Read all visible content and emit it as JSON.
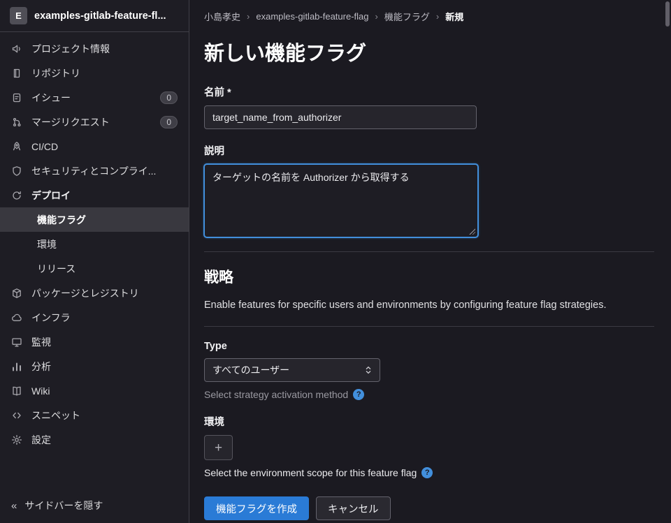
{
  "colors": {
    "page_bg": "#1b1a21",
    "sidebar_bg": "#1e1d24",
    "border": "#403f47",
    "control_border": "#63626c",
    "control_bg": "#26252c",
    "accent_blue": "#428fdc",
    "primary_button": "#2a7bd6",
    "active_item_bg": "#39383f",
    "text_primary": "#ececef",
    "text_muted": "#9a99a1"
  },
  "icons": {
    "help_glyph": "?",
    "collapse_glyph": "«",
    "plus_glyph": "+"
  },
  "sidebar": {
    "project_initial": "E",
    "project_name": "examples-gitlab-feature-fl...",
    "items": [
      {
        "label": "プロジェクト情報"
      },
      {
        "label": "リポジトリ"
      },
      {
        "label": "イシュー",
        "badge": "0"
      },
      {
        "label": "マージリクエスト",
        "badge": "0"
      },
      {
        "label": "CI/CD"
      },
      {
        "label": "セキュリティとコンプライ..."
      },
      {
        "label": "デプロイ",
        "children": [
          {
            "label": "機能フラグ"
          },
          {
            "label": "環境"
          },
          {
            "label": "リリース"
          }
        ]
      },
      {
        "label": "パッケージとレジストリ"
      },
      {
        "label": "インフラ"
      },
      {
        "label": "監視"
      },
      {
        "label": "分析"
      },
      {
        "label": "Wiki"
      },
      {
        "label": "スニペット"
      },
      {
        "label": "設定"
      }
    ],
    "collapse_label": "サイドバーを隠す"
  },
  "breadcrumb": {
    "separator": "›",
    "items": [
      "小島孝史",
      "examples-gitlab-feature-flag",
      "機能フラグ",
      "新規"
    ]
  },
  "main": {
    "title": "新しい機能フラグ",
    "form": {
      "name_label": "名前 *",
      "name_value": "target_name_from_authorizer",
      "description_label": "説明",
      "description_value": "ターゲットの名前を Authorizer から取得する",
      "submit_label": "機能フラグを作成",
      "cancel_label": "キャンセル"
    },
    "strategies": {
      "heading": "戦略",
      "description": "Enable features for specific users and environments by configuring feature flag strategies.",
      "type_label": "Type",
      "type_value": "すべてのユーザー",
      "type_help": "Select strategy activation method",
      "environments_label": "環境",
      "environments_help": "Select the environment scope for this feature flag"
    }
  }
}
